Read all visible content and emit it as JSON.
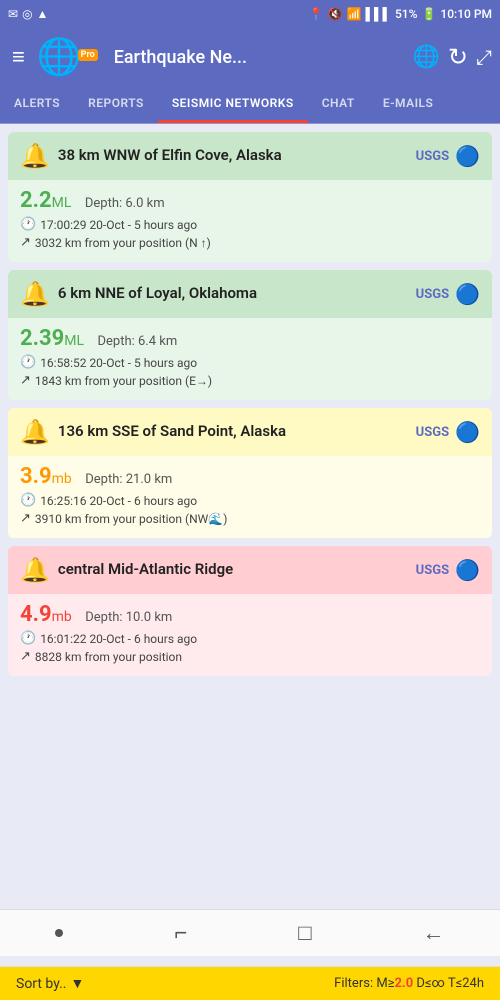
{
  "statusBar": {
    "leftIcons": [
      "✉",
      "◎",
      "▲"
    ],
    "battery": "51%",
    "time": "10:10 PM",
    "signal": "▌▌▌▌",
    "wifi": "WiFi"
  },
  "header": {
    "title": "Earthquake Ne...",
    "menuIcon": "≡",
    "globeIcon": "🌐",
    "refreshIcon": "↻",
    "expandIcon": "⤢",
    "proBadge": "Pro"
  },
  "tabs": [
    {
      "id": "alerts",
      "label": "ALERTS"
    },
    {
      "id": "reports",
      "label": "REPORTS"
    },
    {
      "id": "seismic",
      "label": "SEISMIC NETWORKS",
      "active": true
    },
    {
      "id": "chat",
      "label": "CHAT"
    },
    {
      "id": "emails",
      "label": "E-MAILS"
    }
  ],
  "earthquakes": [
    {
      "id": 1,
      "color": "green",
      "title": "38 km WNW of Elfin Cove, Alaska",
      "source": "USGS",
      "magnitude": "2.2",
      "magType": "ML",
      "depth": "Depth: 6.0 km",
      "time": "17:00:29 20-Oct - 5 hours ago",
      "distance": "3032 km from your position (N ↑)",
      "magColor": "green"
    },
    {
      "id": 2,
      "color": "green",
      "title": "6 km NNE of Loyal, Oklahoma",
      "source": "USGS",
      "magnitude": "2.39",
      "magType": "ML",
      "depth": "Depth: 6.4 km",
      "time": "16:58:52 20-Oct - 5 hours ago",
      "distance": "1843 km from your position (E→)",
      "magColor": "green"
    },
    {
      "id": 3,
      "color": "yellow",
      "title": "136 km SSE of Sand Point, Alaska",
      "source": "USGS",
      "magnitude": "3.9",
      "magType": "mb",
      "depth": "Depth: 21.0 km",
      "time": "16:25:16 20-Oct - 6 hours ago",
      "distance": "3910 km from your position (NW🌊)",
      "magColor": "orange"
    },
    {
      "id": 4,
      "color": "red",
      "title": "central Mid-Atlantic Ridge",
      "source": "USGS",
      "magnitude": "4.9",
      "magType": "mb",
      "depth": "Depth: 10.0 km",
      "time": "16:01:22 20-Oct - 6 hours ago",
      "distance": "8828 km from your position",
      "magColor": "red"
    }
  ],
  "bottomBar": {
    "sortLabel": "Sort by..",
    "filtersLabel": "Filters: M≥",
    "filtersHighlight": "2.0",
    "filtersEnd": " D≤∞ T≤24h"
  },
  "navBar": {
    "icons": [
      "●",
      "⌐",
      "□",
      "←"
    ]
  }
}
